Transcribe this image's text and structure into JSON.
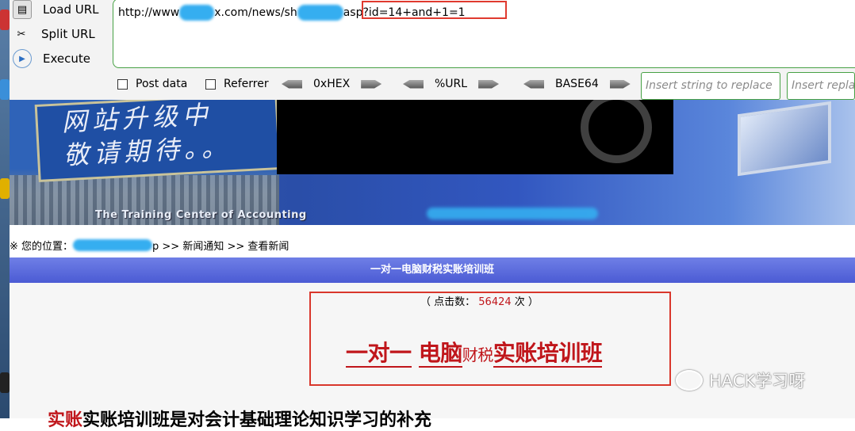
{
  "hackbar": {
    "load_url": "Load URL",
    "split_url": "Split URL",
    "execute": "Execute",
    "url_part1": "http://www",
    "url_part2": "x.com/news/sh",
    "url_part3": "asp",
    "url_injection": "?id=14+and+1=1",
    "post_data": "Post data",
    "referrer": "Referrer",
    "hex": "0xHEX",
    "urlenc": "%URL",
    "base64": "BASE64",
    "replace_placeholder_1": "Insert string to replace",
    "replace_placeholder_2": "Insert replacing string"
  },
  "banner": {
    "line1": "网站升级中",
    "line2": "敬请期待。。",
    "caption": "The Training Center of Accounting"
  },
  "breadcrumb": {
    "prefix": "※ 您的位置：",
    "rest": "p >> 新闻通知 >> 查看新闻"
  },
  "article": {
    "title_bar": "一对一电脑财税实账培训班",
    "hits_label": "（ 点击数：",
    "hits_value": "56424",
    "hits_suffix": " 次 ）",
    "headline_1": "一对一",
    "headline_2": "电脑",
    "headline_3": "财税",
    "headline_4": "实账培训班",
    "body_red": "实账",
    "body": "实账培训班是对会计基础理论知识学习的补充"
  },
  "watermark": "HACK学习呀"
}
